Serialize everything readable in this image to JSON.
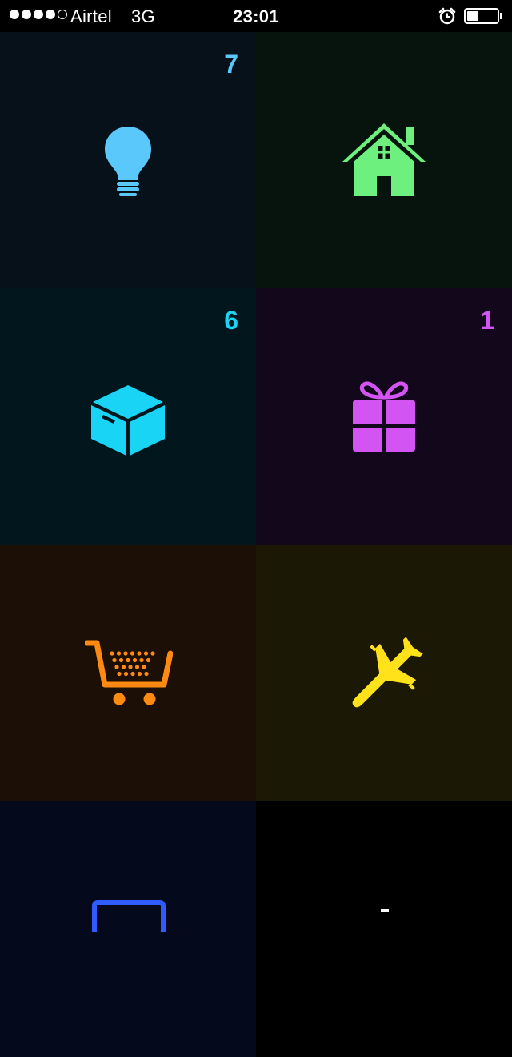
{
  "status_bar": {
    "signal": {
      "filled": 4,
      "total": 5
    },
    "carrier": "Airtel",
    "network": "3G",
    "time": "23:01",
    "battery_level": 0.4
  },
  "tiles": [
    {
      "icon": "lightbulb-icon",
      "badge": "7",
      "color": "#5ac8fa",
      "bg": "#06111a"
    },
    {
      "icon": "house-icon",
      "badge": "",
      "color": "#6ef07e",
      "bg": "#07130d"
    },
    {
      "icon": "box-icon",
      "badge": "6",
      "color": "#19d4f5",
      "bg": "#02161d"
    },
    {
      "icon": "gift-icon",
      "badge": "1",
      "color": "#d254f2",
      "bg": "#13081b"
    },
    {
      "icon": "shopping-cart-icon",
      "badge": "",
      "color": "#ff8a12",
      "bg": "#1c1006"
    },
    {
      "icon": "airplane-icon",
      "badge": "",
      "color": "#ffe21a",
      "bg": "#1b1906"
    },
    {
      "icon": "monitor-icon",
      "badge": "",
      "color": "#2f5bff",
      "bg": "#040a1b"
    },
    {
      "icon": "unknown-icon",
      "badge": "",
      "color": "#ffffff",
      "bg": "#000000"
    }
  ]
}
